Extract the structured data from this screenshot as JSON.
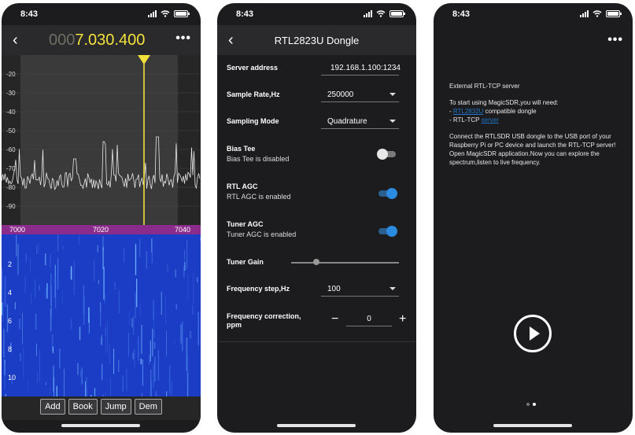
{
  "status": {
    "time": "8:43"
  },
  "screen1": {
    "frequency_dim": "000",
    "frequency_bright": "7.030.400",
    "db_labels": [
      "-20",
      "-30",
      "-40",
      "-50",
      "-60",
      "-70",
      "-80",
      "-90"
    ],
    "freq_labels": [
      "7000",
      "7020",
      "7040"
    ],
    "waterfall_labels": [
      "2",
      "4",
      "6",
      "8",
      "10"
    ],
    "toolbar": [
      "Add",
      "Book",
      "Jump",
      "Dem"
    ],
    "colors": {
      "freq_bar": "#8b2c8c",
      "marker": "#f2e23c",
      "waterfall": "#1b3cc4"
    }
  },
  "screen2": {
    "title": "RTL2823U Dongle",
    "server_address_label": "Server address",
    "server_address_value": "192.168.1.100:1234",
    "sample_rate_label": "Sample Rate,Hz",
    "sample_rate_value": "250000",
    "sampling_mode_label": "Sampling Mode",
    "sampling_mode_value": "Quadrature",
    "bias_tee_label": "Bias Tee",
    "bias_tee_status": "Bias Tee is disabled",
    "rtl_agc_label": "RTL AGC",
    "rtl_agc_status": "RTL AGC is enabled",
    "tuner_agc_label": "Tuner AGC",
    "tuner_agc_status": "Tuner AGC is enabled",
    "tuner_gain_label": "Tuner Gain",
    "freq_step_label": "Frequency step,Hz",
    "freq_step_value": "100",
    "freq_correction_label_1": "Frequency correction,",
    "freq_correction_label_2": "ppm",
    "freq_correction_value": "0",
    "minus": "−",
    "plus": "+"
  },
  "screen3": {
    "heading": "External RTL-TCP server",
    "intro": "To start using MagicSDR,you will need:",
    "item1_prefix": "- ",
    "item1_link": "RTL2832U",
    "item1_suffix": " compatible dongle",
    "item2_prefix": "- RTL-TCP ",
    "item2_link": "server",
    "paragraph": "Connect the RTLSDR USB dongle to the  USB port of your Raspberry Pi or PC device and launch the RTL-TCP server! Open MagicSDR application.Now you can explore the spectrum,listen to live frequency."
  }
}
